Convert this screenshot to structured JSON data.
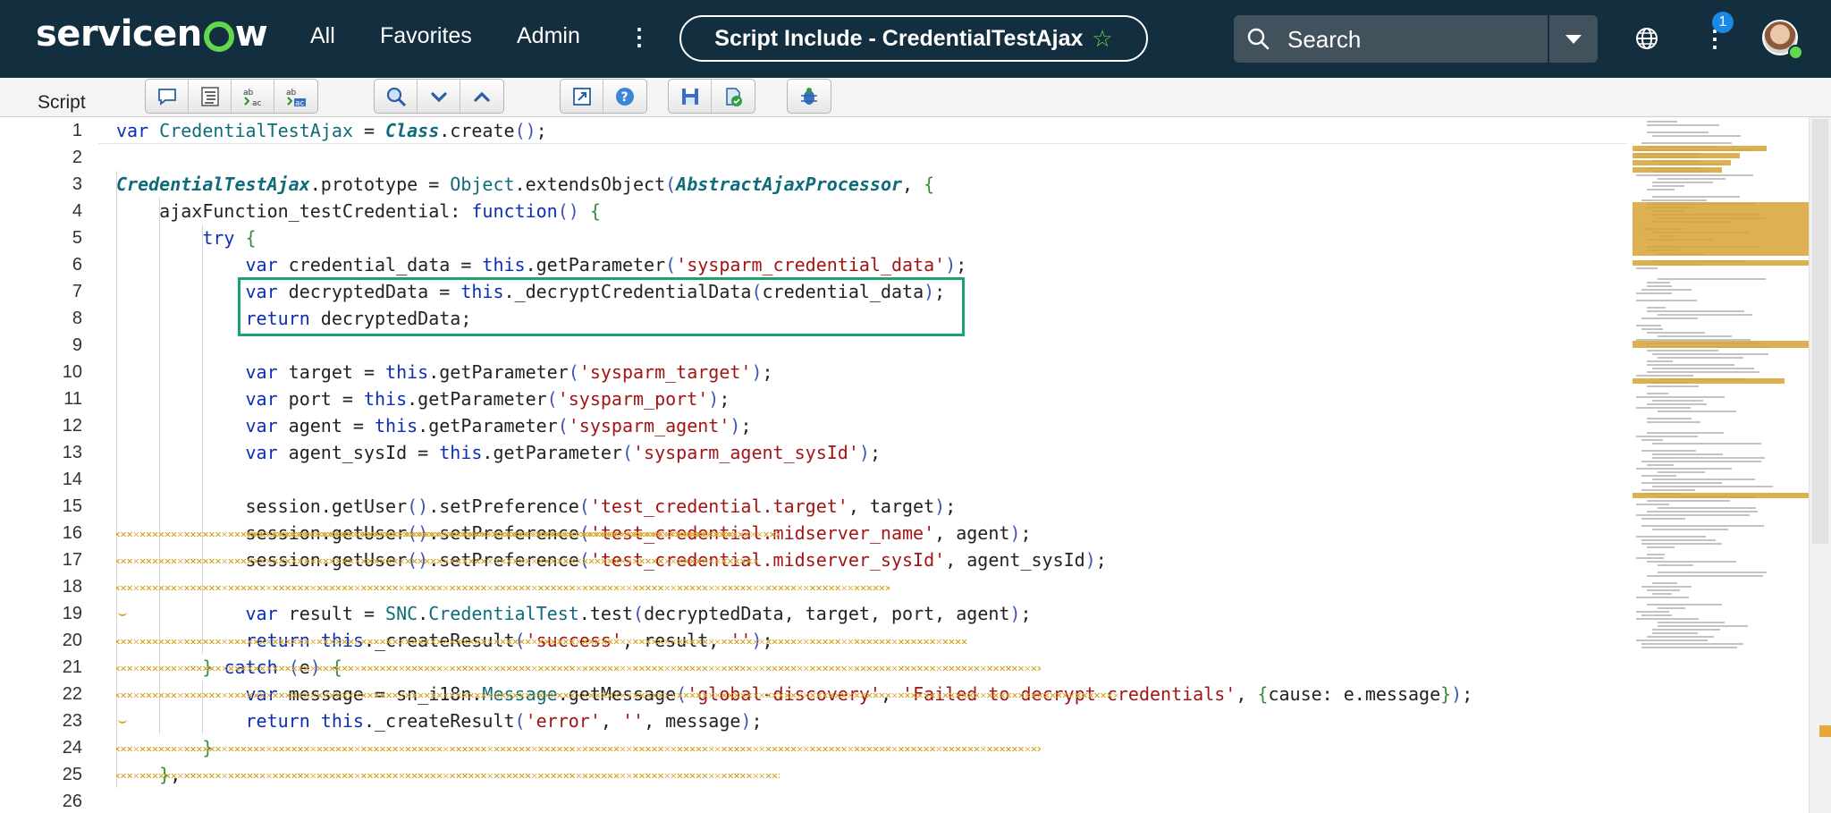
{
  "nav": {
    "logo_text_1": "servicen",
    "logo_text_2": "w",
    "links": [
      "All",
      "Favorites",
      "Admin"
    ],
    "context_title": "Script Include - CredentialTestAjax",
    "search_placeholder": "Search",
    "notification_count": "1",
    "colors": {
      "bar": "#132e3e",
      "accent": "#62d84e",
      "badge": "#1a89e6"
    }
  },
  "toolbar": {
    "label": "Script",
    "icons": [
      "comment-icon",
      "format-code-icon",
      "replace-icon",
      "replace-all-icon",
      "search-icon",
      "next-icon",
      "previous-icon",
      "fullscreen-icon",
      "help-icon",
      "save-icon",
      "check-syntax-icon",
      "debug-icon"
    ]
  },
  "editor": {
    "highlight_color": "#1aa46a",
    "warning_color": "#d7a21f",
    "lines": [
      {
        "n": "1",
        "code": [
          [
            "k",
            "var "
          ],
          [
            "t",
            "CredentialTestAjax"
          ],
          [
            "p",
            " = "
          ],
          [
            "ti",
            "Class"
          ],
          [
            "p",
            ".create"
          ],
          [
            "br",
            "()"
          ],
          [
            "p",
            ";"
          ]
        ]
      },
      {
        "n": "2",
        "code": []
      },
      {
        "n": "3",
        "code": [
          [
            "ti",
            "CredentialTestAjax"
          ],
          [
            "p",
            ".prototype = "
          ],
          [
            "t",
            "Object"
          ],
          [
            "p",
            ".extendsObject"
          ],
          [
            "br",
            "("
          ],
          [
            "ti",
            "AbstractAjaxProcessor"
          ],
          [
            "p",
            ", "
          ],
          [
            "br2",
            "{"
          ]
        ]
      },
      {
        "n": "4",
        "code": [
          [
            "p",
            "    ajaxFunction_testCredential: "
          ],
          [
            "k",
            "function"
          ],
          [
            "br",
            "()"
          ],
          [
            "p",
            " "
          ],
          [
            "br2",
            "{"
          ]
        ]
      },
      {
        "n": "5",
        "code": [
          [
            "p",
            "        "
          ],
          [
            "k",
            "try"
          ],
          [
            "p",
            " "
          ],
          [
            "br2",
            "{"
          ]
        ]
      },
      {
        "n": "6",
        "code": [
          [
            "p",
            "            "
          ],
          [
            "k",
            "var"
          ],
          [
            "p",
            " credential_data = "
          ],
          [
            "k",
            "this"
          ],
          [
            "p",
            ".getParameter"
          ],
          [
            "br",
            "("
          ],
          [
            "s",
            "'sysparm_credential_data'"
          ],
          [
            "br",
            ")"
          ],
          [
            "p",
            ";"
          ]
        ]
      },
      {
        "n": "7",
        "code": [
          [
            "p",
            "            "
          ],
          [
            "k",
            "var"
          ],
          [
            "p",
            " decryptedData = "
          ],
          [
            "k",
            "this"
          ],
          [
            "p",
            "._decryptCredentialData"
          ],
          [
            "br",
            "("
          ],
          [
            "p",
            "credential_data"
          ],
          [
            "br",
            ")"
          ],
          [
            "p",
            ";"
          ]
        ]
      },
      {
        "n": "8",
        "code": [
          [
            "p",
            "            "
          ],
          [
            "k",
            "return"
          ],
          [
            "p",
            " decryptedData;"
          ]
        ]
      },
      {
        "n": "9",
        "code": []
      },
      {
        "n": "10",
        "code": [
          [
            "p",
            "            "
          ],
          [
            "k",
            "var"
          ],
          [
            "p",
            " target = "
          ],
          [
            "k",
            "this"
          ],
          [
            "p",
            ".getParameter"
          ],
          [
            "br",
            "("
          ],
          [
            "s",
            "'sysparm_target'"
          ],
          [
            "br",
            ")"
          ],
          [
            "p",
            ";"
          ]
        ]
      },
      {
        "n": "11",
        "code": [
          [
            "p",
            "            "
          ],
          [
            "k",
            "var"
          ],
          [
            "p",
            " port = "
          ],
          [
            "k",
            "this"
          ],
          [
            "p",
            ".getParameter"
          ],
          [
            "br",
            "("
          ],
          [
            "s",
            "'sysparm_port'"
          ],
          [
            "br",
            ")"
          ],
          [
            "p",
            ";"
          ]
        ]
      },
      {
        "n": "12",
        "code": [
          [
            "p",
            "            "
          ],
          [
            "k",
            "var"
          ],
          [
            "p",
            " agent = "
          ],
          [
            "k",
            "this"
          ],
          [
            "p",
            ".getParameter"
          ],
          [
            "br",
            "("
          ],
          [
            "s",
            "'sysparm_agent'"
          ],
          [
            "br",
            ")"
          ],
          [
            "p",
            ";"
          ]
        ]
      },
      {
        "n": "13",
        "code": [
          [
            "p",
            "            "
          ],
          [
            "k",
            "var"
          ],
          [
            "p",
            " agent_sysId = "
          ],
          [
            "k",
            "this"
          ],
          [
            "p",
            ".getParameter"
          ],
          [
            "br",
            "("
          ],
          [
            "s",
            "'sysparm_agent_sysId'"
          ],
          [
            "br",
            ")"
          ],
          [
            "p",
            ";"
          ]
        ]
      },
      {
        "n": "14",
        "code": []
      },
      {
        "n": "15",
        "code": [
          [
            "p",
            "            session.getUser"
          ],
          [
            "br",
            "()"
          ],
          [
            "p",
            ".setPreference"
          ],
          [
            "br",
            "("
          ],
          [
            "s",
            "'test_credential.target'"
          ],
          [
            "p",
            ", target"
          ],
          [
            "br",
            ")"
          ],
          [
            "p",
            ";"
          ]
        ]
      },
      {
        "n": "16",
        "code": [
          [
            "p",
            "            session.getUser"
          ],
          [
            "br",
            "()"
          ],
          [
            "p",
            ".setPreference"
          ],
          [
            "br",
            "("
          ],
          [
            "s",
            "'test_credential.midserver_name'"
          ],
          [
            "p",
            ", agent"
          ],
          [
            "br",
            ")"
          ],
          [
            "p",
            ";"
          ]
        ]
      },
      {
        "n": "17",
        "code": [
          [
            "p",
            "            session.getUser"
          ],
          [
            "br",
            "()"
          ],
          [
            "p",
            ".setPreference"
          ],
          [
            "br",
            "("
          ],
          [
            "s",
            "'test_credential.midserver_sysId'"
          ],
          [
            "p",
            ", agent_sysId"
          ],
          [
            "br",
            ")"
          ],
          [
            "p",
            ";"
          ]
        ]
      },
      {
        "n": "18",
        "code": []
      },
      {
        "n": "19",
        "code": [
          [
            "p",
            "            "
          ],
          [
            "k",
            "var"
          ],
          [
            "p",
            " result = "
          ],
          [
            "t",
            "SNC"
          ],
          [
            "p",
            "."
          ],
          [
            "t",
            "CredentialTest"
          ],
          [
            "p",
            ".test"
          ],
          [
            "br",
            "("
          ],
          [
            "p",
            "decryptedData, target, port, agent"
          ],
          [
            "br",
            ")"
          ],
          [
            "p",
            ";"
          ]
        ]
      },
      {
        "n": "20",
        "code": [
          [
            "p",
            "            "
          ],
          [
            "k",
            "return this"
          ],
          [
            "p",
            "._createResult"
          ],
          [
            "br",
            "("
          ],
          [
            "s",
            "'success'"
          ],
          [
            "p",
            ", result, "
          ],
          [
            "s",
            "''"
          ],
          [
            "br",
            ")"
          ],
          [
            "p",
            ";"
          ]
        ]
      },
      {
        "n": "21",
        "code": [
          [
            "p",
            "        "
          ],
          [
            "br2",
            "}"
          ],
          [
            "p",
            " "
          ],
          [
            "k",
            "catch"
          ],
          [
            "p",
            " "
          ],
          [
            "br",
            "("
          ],
          [
            "p",
            "e"
          ],
          [
            "br",
            ")"
          ],
          [
            "p",
            " "
          ],
          [
            "br2",
            "{"
          ]
        ]
      },
      {
        "n": "22",
        "code": [
          [
            "p",
            "            "
          ],
          [
            "k",
            "var"
          ],
          [
            "p",
            " message = sn_i18n."
          ],
          [
            "t",
            "Message"
          ],
          [
            "p",
            ".getMessage"
          ],
          [
            "br",
            "("
          ],
          [
            "s",
            "'global-discovery'"
          ],
          [
            "p",
            ", "
          ],
          [
            "s",
            "'Failed to decrypt credentials'"
          ],
          [
            "p",
            ", "
          ],
          [
            "br2",
            "{"
          ],
          [
            "p",
            "cause: e.message"
          ],
          [
            "br2",
            "}"
          ],
          [
            "br",
            ")"
          ],
          [
            "p",
            ";"
          ]
        ]
      },
      {
        "n": "23",
        "code": [
          [
            "p",
            "            "
          ],
          [
            "k",
            "return this"
          ],
          [
            "p",
            "._createResult"
          ],
          [
            "br",
            "("
          ],
          [
            "s",
            "'error'"
          ],
          [
            "p",
            ", "
          ],
          [
            "s",
            "''"
          ],
          [
            "p",
            ", message"
          ],
          [
            "br",
            ")"
          ],
          [
            "p",
            ";"
          ]
        ]
      },
      {
        "n": "24",
        "code": [
          [
            "p",
            "        "
          ],
          [
            "br2",
            "}"
          ]
        ]
      },
      {
        "n": "25",
        "code": [
          [
            "p",
            "    "
          ],
          [
            "br2",
            "}"
          ],
          [
            "p",
            ","
          ]
        ]
      },
      {
        "n": "26",
        "code": []
      }
    ]
  }
}
